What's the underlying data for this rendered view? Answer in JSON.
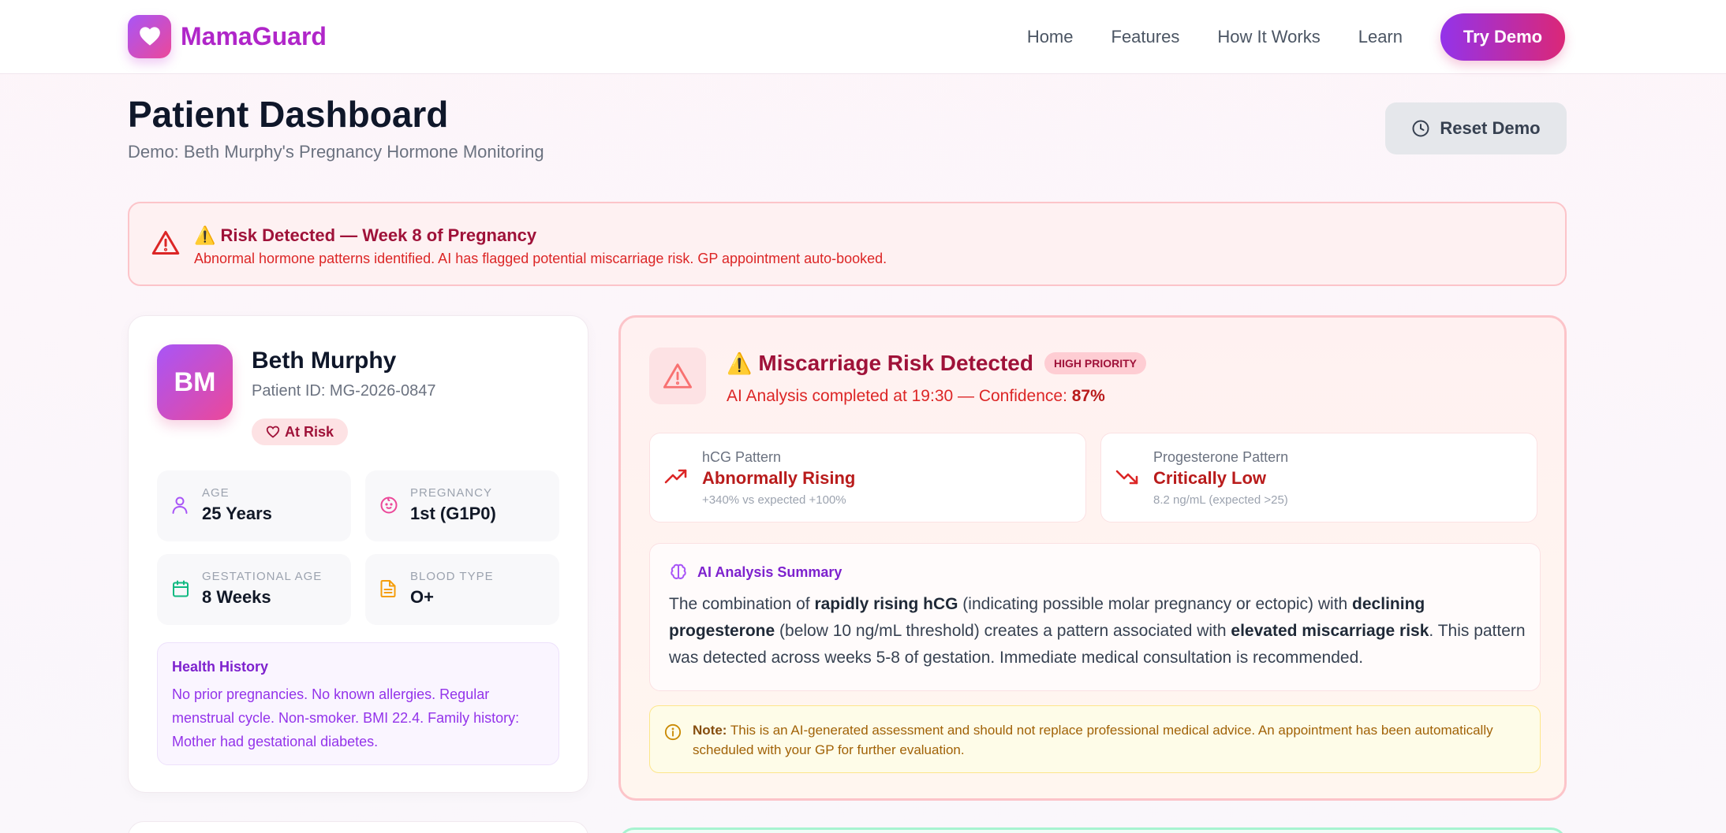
{
  "brand": {
    "name": "MamaGuard"
  },
  "nav": {
    "links": [
      "Home",
      "Features",
      "How It Works",
      "Learn"
    ],
    "cta": "Try Demo"
  },
  "header": {
    "title": "Patient Dashboard",
    "subtitle": "Demo: Beth Murphy's Pregnancy Hormone Monitoring",
    "reset_label": "Reset Demo"
  },
  "alert": {
    "title": "⚠️ Risk Detected — Week 8 of Pregnancy",
    "description": "Abnormal hormone patterns identified. AI has flagged potential miscarriage risk. GP appointment auto-booked."
  },
  "patient": {
    "initials": "BM",
    "name": "Beth Murphy",
    "id": "Patient ID: MG-2026-0847",
    "status": "At Risk",
    "stats": [
      {
        "label": "AGE",
        "value": "25 Years",
        "icon": "user-icon"
      },
      {
        "label": "PREGNANCY",
        "value": "1st (G1P0)",
        "icon": "baby-icon"
      },
      {
        "label": "GESTATIONAL AGE",
        "value": "8 Weeks",
        "icon": "calendar-icon"
      },
      {
        "label": "BLOOD TYPE",
        "value": "O+",
        "icon": "document-icon"
      }
    ],
    "history": {
      "title": "Health History",
      "text": "No prior pregnancies. No known allergies. Regular menstrual cycle. Non-smoker. BMI 22.4. Family history: Mother had gestational diabetes."
    }
  },
  "risk": {
    "title_emoji": "⚠️",
    "title": "Miscarriage Risk Detected",
    "priority": "HIGH PRIORITY",
    "analysis_prefix": "AI Analysis completed at 19:30 — Confidence: ",
    "confidence": "87%",
    "patterns": [
      {
        "label": "hCG Pattern",
        "value": "Abnormally Rising",
        "note": "+340% vs expected +100%",
        "icon": "trending-up-icon"
      },
      {
        "label": "Progesterone Pattern",
        "value": "Critically Low",
        "note": "8.2 ng/mL (expected >25)",
        "icon": "trending-down-icon"
      }
    ],
    "summary": {
      "title": "AI Analysis Summary",
      "t1": "The combination of ",
      "b1": "rapidly rising hCG",
      "t2": " (indicating possible molar pregnancy or ectopic) with ",
      "b2": "declining progesterone",
      "t3": " (below 10 ng/mL threshold) creates a pattern associated with ",
      "b3": "elevated miscarriage risk",
      "t4": ". This pattern was detected across weeks 5-8 of gestation. Immediate medical consultation is recommended."
    },
    "note": {
      "label": "Note:",
      "text": " This is an AI-generated assessment and should not replace professional medical advice. An appointment has been automatically scheduled with your GP for further evaluation."
    }
  },
  "colors": {
    "brand_purple": "#9333ea",
    "brand_pink": "#db2777",
    "danger": "#dc2626",
    "danger_bg": "#fef1f2"
  }
}
